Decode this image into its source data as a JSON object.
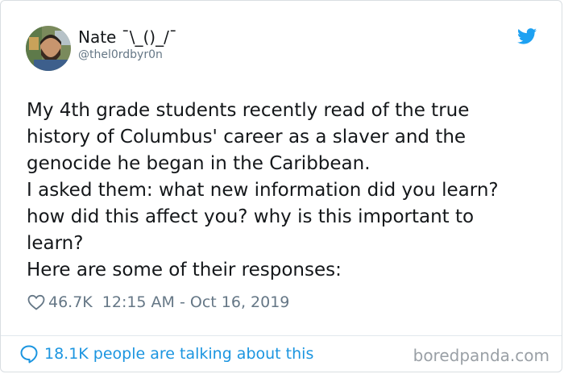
{
  "author": {
    "display_name": "Nate ¯\\_()_/¯",
    "handle": "@thel0rdbyr0n"
  },
  "icons": {
    "brand": "twitter-bird-icon",
    "like": "heart-icon",
    "reply": "speech-bubble-icon"
  },
  "colors": {
    "brand_blue": "#1da1f2",
    "link_blue": "#1b95e0",
    "muted_text": "#657786",
    "body_text": "#14171a"
  },
  "tweet": {
    "lines": [
      "My 4th grade students recently read of the true",
      "history of Columbus' career as a slaver and the",
      "genocide he began in the Caribbean.",
      "I asked them: what new information did you learn?",
      "how did this affect you? why is this important to",
      "learn?",
      "Here are some of their responses:"
    ],
    "likes": "46.7K",
    "timestamp": "12:15 AM - Oct 16, 2019"
  },
  "footer": {
    "conversation_label": "18.1K people are talking about this"
  },
  "watermark": "boredpanda.com"
}
